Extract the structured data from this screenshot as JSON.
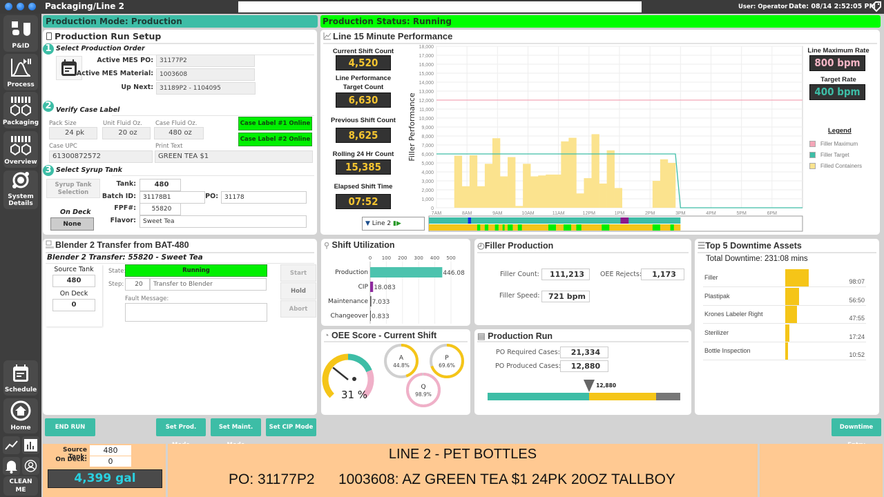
{
  "header": {
    "title": "Packaging/Line 2",
    "search_value": "",
    "user": "User: Operator",
    "date": "Date: 08/14 2:52:05 PM"
  },
  "sidebar": {
    "items": [
      {
        "label": "P&ID",
        "icon": "pid-icon"
      },
      {
        "label": "Process",
        "icon": "process-icon"
      },
      {
        "label": "Packaging",
        "icon": "packaging-icon"
      },
      {
        "label": "Overview",
        "icon": "overview-icon"
      },
      {
        "label": "System Details",
        "icon": "system-details-icon"
      },
      {
        "label": "Schedule",
        "icon": "schedule-icon"
      },
      {
        "label": "Home",
        "icon": "home-icon"
      },
      {
        "label": "CLEAN ME",
        "icon": ""
      }
    ]
  },
  "mode_bar": {
    "mode": "Production Mode: Production",
    "status": "Production Status: Running",
    "mode_color": "#3dbda6",
    "status_color": "#00ff00"
  },
  "setup": {
    "title": "Production Run Setup",
    "step1": {
      "num": "1",
      "title": "Select Production  Order",
      "po_label": "Active MES PO:",
      "po": "31177P2",
      "material_label": "Active MES Material:",
      "material": "1003608",
      "next_label": "Up Next:",
      "next": "31189P2 - 1104095"
    },
    "step2": {
      "num": "2",
      "title": "Verify Case Label",
      "pack_label": "Pack Size",
      "pack": "24 pk",
      "unit_label": "Unit Fluid Oz.",
      "unit": "20 oz",
      "case_label": "Case Fluid Oz.",
      "case": "480 oz",
      "upc_label": "Case UPC",
      "upc": "61300872572",
      "print_label": "Print Text",
      "print": "GREEN TEA $1",
      "label1": "Case Label #1 Online",
      "label2": "Case Label #2 Online"
    },
    "step3": {
      "num": "3",
      "title": "Select Syrup Tank",
      "tank_btn": "Syrup Tank Selection",
      "ondeck_label": "On Deck",
      "ondeck": "None",
      "tank_label": "Tank:",
      "tank": "480",
      "batch_label": "Batch ID:",
      "batch": "31178B1",
      "po_label": "PO:",
      "po": "31178",
      "fpf_label": "FPF#:",
      "fpf": "55820",
      "flavor_label": "Flavor:",
      "flavor": "Sweet Tea"
    }
  },
  "performance": {
    "title": "Line 15 Minute Performance",
    "kpis": [
      {
        "label": "Current Shift Count",
        "value": "4,520"
      },
      {
        "label": "Line Performance Target Count",
        "value": "6,630"
      },
      {
        "label": "Previous Shift Count",
        "value": "8,625"
      },
      {
        "label": "Rolling 24 Hr Count",
        "value": "15,385"
      },
      {
        "label": "Elapsed Shift Time",
        "value": "07:52"
      }
    ],
    "max_rate_label": "Line Maximum Rate",
    "max_rate": "800 bpm",
    "target_rate_label": "Target Rate",
    "target_rate": "400 bpm",
    "legend_title": "Legend",
    "timeline_label": "Line 2"
  },
  "chart_data": {
    "type": "bar",
    "ylabel": "Filler Performance",
    "xlabel": "",
    "ylim": [
      0,
      18000
    ],
    "yticks": [
      "0",
      "1,000",
      "2,000",
      "3,000",
      "4,000",
      "5,000",
      "6,000",
      "7,000",
      "8,000",
      "9,000",
      "10,000",
      "11,000",
      "12,000",
      "13,000",
      "14,000",
      "15,000",
      "16,000",
      "17,000",
      "18,000"
    ],
    "xlim": [
      "7AM",
      "7PM"
    ],
    "xticks": [
      "7AM",
      "8AM",
      "9AM",
      "10AM",
      "11AM",
      "12PM",
      "1PM",
      "2PM",
      "3PM",
      "4PM",
      "5PM",
      "6PM"
    ],
    "grid": true,
    "legend_position": "right",
    "series": [
      {
        "name": "Filler Maximum",
        "type": "line",
        "color": "#f4a6b8",
        "points": [
          [
            "7:00",
            12000
          ],
          [
            "19:00",
            12000
          ]
        ]
      },
      {
        "name": "Filler Target",
        "type": "line",
        "color": "#3dbda6",
        "points": [
          [
            "7:00",
            6000
          ],
          [
            "14:50",
            6000
          ],
          [
            "15:00",
            0
          ],
          [
            "19:00",
            0
          ]
        ]
      },
      {
        "name": "Filled Containers",
        "type": "bar",
        "color": "#fbe38e",
        "bar_minutes": 15,
        "x": [
          "7:35",
          "7:50",
          "8:05",
          "8:20",
          "8:35",
          "8:50",
          "9:05",
          "9:20",
          "9:35",
          "9:50",
          "10:05",
          "10:20",
          "10:35",
          "10:50",
          "11:05",
          "11:20",
          "11:35",
          "11:50",
          "12:05",
          "12:20",
          "12:35",
          "12:50",
          "14:05",
          "14:20",
          "14:35"
        ],
        "values": [
          5800,
          2400,
          5850,
          2400,
          4900,
          7750,
          3500,
          5650,
          200,
          4900,
          3500,
          3600,
          3700,
          3700,
          7400,
          7800,
          1600,
          3300,
          8200,
          2700,
          6400,
          2200,
          3000,
          5400,
          5000
        ]
      }
    ],
    "timeline": {
      "top": {
        "base": "#3dbda6",
        "events": [
          {
            "start": "8:02",
            "end": "8:08",
            "color": "#1030e0"
          },
          {
            "start": "13:02",
            "end": "13:18",
            "color": "#8b1a8b"
          }
        ],
        "end": "15:00"
      },
      "bottom": {
        "base": "#f5c518",
        "events": [
          {
            "start": "8:20",
            "end": "8:26",
            "color": "#00ee00"
          },
          {
            "start": "8:35",
            "end": "8:42",
            "color": "#00ee00"
          },
          {
            "start": "8:55",
            "end": "9:02",
            "color": "#00ee00"
          },
          {
            "start": "9:10",
            "end": "9:14",
            "color": "#00ee00"
          },
          {
            "start": "9:20",
            "end": "9:30",
            "color": "#00ee00"
          },
          {
            "start": "9:40",
            "end": "9:48",
            "color": "#00ee00"
          },
          {
            "start": "10:40",
            "end": "10:55",
            "color": "#00ee00"
          },
          {
            "start": "11:10",
            "end": "11:25",
            "color": "#00ee00"
          },
          {
            "start": "11:35",
            "end": "11:45",
            "color": "#00ee00"
          },
          {
            "start": "12:25",
            "end": "12:40",
            "color": "#00ee00"
          },
          {
            "start": "14:05",
            "end": "14:20",
            "color": "#00ee00"
          },
          {
            "start": "14:40",
            "end": "14:47",
            "color": "#00ee00"
          }
        ],
        "end": "15:00"
      }
    }
  },
  "blender": {
    "title": "Blender 2 Transfer from BAT-480",
    "subtitle": "Blender 2 Transfer: 55820 - Sweet Tea",
    "source_label": "Source Tank",
    "source": "480",
    "ondeck_label": "On Deck",
    "ondeck": "0",
    "state_label": "State:",
    "state": "Running",
    "step_label": "Step:",
    "step": "20",
    "step_text": "Transfer to Blender",
    "fault_label": "Fault Message:",
    "fault": "",
    "start": "Start",
    "hold": "Hold",
    "abort": "Abort"
  },
  "utilization": {
    "title": "Shift Utilization",
    "ticks": [
      "0",
      "100",
      "200",
      "300",
      "400",
      "500"
    ],
    "max": 500,
    "rows": [
      {
        "label": "Production",
        "value": 446.08,
        "text": "446.08",
        "color": "#4cc3ae"
      },
      {
        "label": "CIP",
        "value": 18.083,
        "text": "18.083",
        "color": "#8e2a9e"
      },
      {
        "label": "Maintenance",
        "value": 7.033,
        "text": "7.033",
        "color": "#555"
      },
      {
        "label": "Changeover",
        "value": 0.833,
        "text": "0.833",
        "color": "#555"
      }
    ]
  },
  "oee": {
    "title": "OEE Score - Current Shift",
    "score": 31,
    "score_text": "31 %",
    "rings": [
      {
        "label": "A",
        "value": 44.8,
        "text": "44.8%",
        "color": "#f5c518"
      },
      {
        "label": "P",
        "value": 69.6,
        "text": "69.6%",
        "color": "#f5c518"
      },
      {
        "label": "Q",
        "value": 98.9,
        "text": "98.9%",
        "color": "#f0b0c8"
      }
    ]
  },
  "filler": {
    "title": "Filler Production",
    "count_label": "Filler Count:",
    "count": "111,213",
    "rejects_label": "OEE Rejects:",
    "rejects": "1,173",
    "speed_label": "Filler Speed:",
    "speed": "721 bpm"
  },
  "run": {
    "title": "Production Run",
    "req_label": "PO Required Cases:",
    "req": "21,334",
    "req_value": 21334,
    "prod_label": "PO Produced Cases:",
    "prod": "12,880",
    "prod_value": 12880,
    "marker": "12,880"
  },
  "downtime": {
    "title": "Top 5 Downtime Assets",
    "total": "Total Downtime: 231:08 mins",
    "rows": [
      {
        "label": "Filler",
        "time": "98:07",
        "minutes": 98.1
      },
      {
        "label": "Plastipak",
        "time": "56:50",
        "minutes": 56.8
      },
      {
        "label": "Krones Labeler Right",
        "time": "47:55",
        "minutes": 47.9
      },
      {
        "label": "Sterilizer",
        "time": "17:24",
        "minutes": 17.4
      },
      {
        "label": "Bottle Inspection",
        "time": "10:52",
        "minutes": 10.9
      }
    ]
  },
  "actions": {
    "end_run": "END RUN",
    "prod_mode": "Set Prod. Mode",
    "maint_mode": "Set Maint. Mode",
    "cip_mode": "Set CIP Mode",
    "downtime_entry": "Downtime Entry"
  },
  "footer": {
    "source_label": "Source Tank:",
    "source": "480",
    "ondeck_label": "On Deck:",
    "ondeck": "0",
    "gallons": "4,399 gal",
    "line": "LINE 2 - PET BOTTLES",
    "po": "PO: 31177P2",
    "material": "1003608: AZ GREEN TEA $1 24PK 20OZ TALLBOY"
  }
}
